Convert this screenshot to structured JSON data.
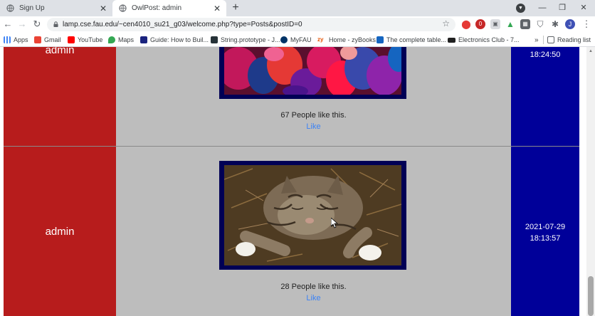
{
  "browser": {
    "tabs": [
      {
        "title": "Sign Up",
        "active": false
      },
      {
        "title": "OwlPost: admin",
        "active": true
      }
    ],
    "url": "lamp.cse.fau.edu/~cen4010_su21_g03/welcome.php?type=Posts&postID=0",
    "extension_badge": "0",
    "profile_initial": "J",
    "bookmarks": [
      "Apps",
      "Gmail",
      "YouTube",
      "Maps",
      "Guide: How to Buil...",
      "String.prototype - J...",
      "MyFAU",
      "Home - zyBooks",
      "The complete table...",
      "Electronics Club - 7..."
    ],
    "bookmarks_overflow": "»",
    "reading_list": "Reading list"
  },
  "page": {
    "colors": {
      "author_column": "#b71c1c",
      "content_column": "#bdbdbd",
      "date_column": "#000099",
      "image_frame": "#000055",
      "like_link": "#3b82f6"
    },
    "posts": [
      {
        "author": "admin",
        "date": "",
        "time": "18:24:50",
        "likes_text": "67 People like this.",
        "like_label": "Like",
        "image": "colorful-crowd-photo"
      },
      {
        "author": "admin",
        "date": "2021-07-29",
        "time": "18:13:57",
        "likes_text": "28 People like this.",
        "like_label": "Like",
        "image": "sleeping-tabby-cat-photo"
      }
    ]
  }
}
